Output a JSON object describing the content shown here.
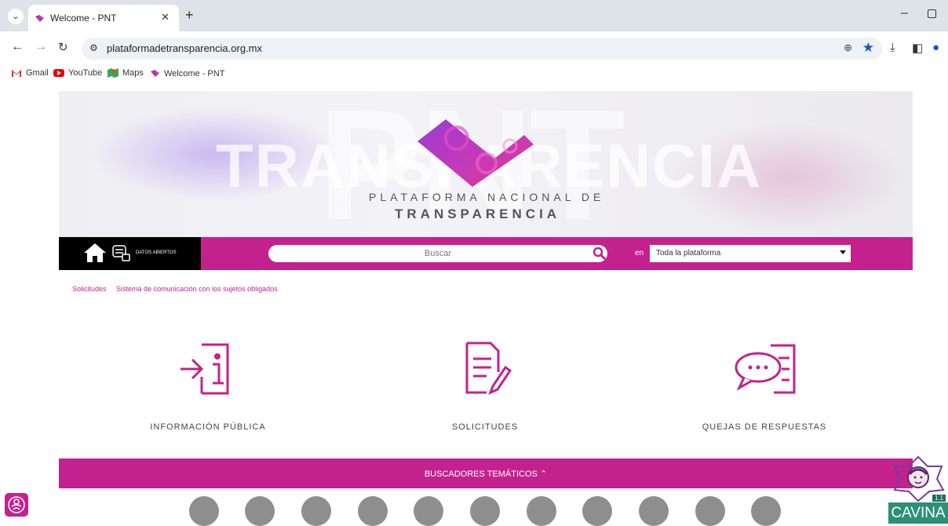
{
  "browser": {
    "tab_title": "Welcome - PNT",
    "url": "plataformadetransparencia.org.mx",
    "bookmarks": [
      "Gmail",
      "YouTube",
      "Maps",
      "Welcome - PNT"
    ]
  },
  "hero": {
    "watermark_big": "PNT",
    "watermark_word": "TRANSPARENCIA",
    "title_line1": "PLATAFORMA NACIONAL DE",
    "title_line2": "TRANSPARENCIA"
  },
  "searchbar": {
    "datos_label": "DATOS ABIERTOS",
    "placeholder": "Buscar",
    "en_label": "en",
    "scope_value": "Toda la plataforma"
  },
  "breadcrumb": [
    "Solicitudes",
    "Sistema de comunicación con los sujetos obligados"
  ],
  "features": [
    {
      "label": "INFORMACIÓN PÚBLICA"
    },
    {
      "label": "SOLICITUDES"
    },
    {
      "label": "QUEJAS DE RESPUESTAS"
    }
  ],
  "bottombar": {
    "label": "BUSCADORES TEMÁTICOS ⌃"
  },
  "cavina": {
    "word": "CAVINA",
    "version": "1.1"
  },
  "colors": {
    "brand": "#c3228e",
    "cavina": "#2d8f78"
  }
}
